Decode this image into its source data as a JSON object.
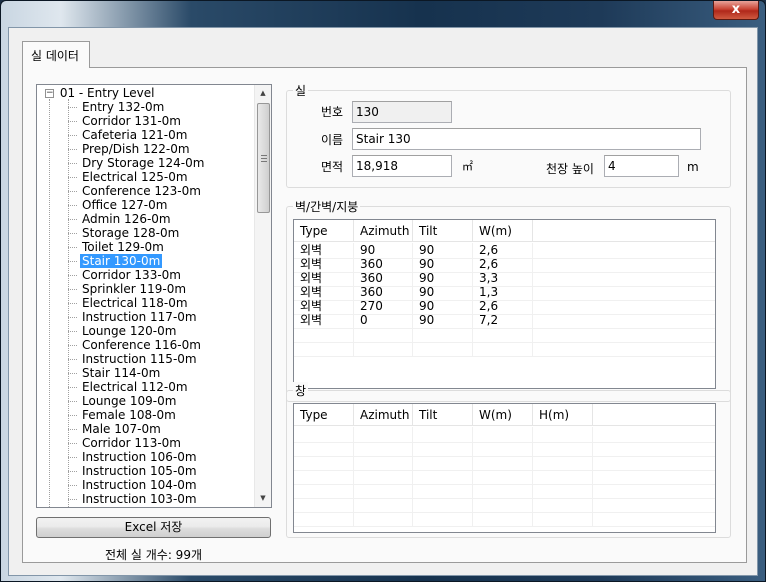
{
  "window": {
    "close_glyph": "x"
  },
  "tab": {
    "label": "실 데이터"
  },
  "tree": {
    "root_label": "01 - Entry Level",
    "expander_glyph": "−",
    "items": [
      "Entry 132-0m",
      "Corridor 131-0m",
      "Cafeteria 121-0m",
      "Prep/Dish 122-0m",
      "Dry Storage 124-0m",
      "Electrical 125-0m",
      "Conference 123-0m",
      "Office 127-0m",
      "Admin 126-0m",
      "Storage 128-0m",
      "Toilet 129-0m",
      "Stair 130-0m",
      "Corridor 133-0m",
      "Sprinkler 119-0m",
      "Electrical 118-0m",
      "Instruction 117-0m",
      "Lounge 120-0m",
      "Conference 116-0m",
      "Instruction 115-0m",
      "Stair 114-0m",
      "Electrical 112-0m",
      "Lounge 109-0m",
      "Female 108-0m",
      "Male 107-0m",
      "Corridor 113-0m",
      "Instruction 106-0m",
      "Instruction 105-0m",
      "Instruction 104-0m",
      "Instruction 103-0m"
    ],
    "selected_index": 11,
    "scroll": {
      "up_glyph": "▲",
      "down_glyph": "▼"
    }
  },
  "excel_button": {
    "label": "Excel 저장"
  },
  "count_label": "전체 실 개수: 99개",
  "room": {
    "group_title": "실",
    "number_label": "번호",
    "number_value": "130",
    "name_label": "이름",
    "name_value": "Stair 130",
    "area_label": "면적",
    "area_value": "18,918",
    "area_unit": "㎡",
    "height_label": "천장 높이",
    "height_value": "4",
    "height_unit": "m"
  },
  "walls": {
    "group_title": "벽/간벽/지붕",
    "columns": [
      "Type",
      "Azimuth",
      "Tilt",
      "W(m)"
    ],
    "rows": [
      [
        "외벽",
        "90",
        "90",
        "2,6"
      ],
      [
        "외벽",
        "360",
        "90",
        "2,6"
      ],
      [
        "외벽",
        "360",
        "90",
        "3,3"
      ],
      [
        "외벽",
        "360",
        "90",
        "1,3"
      ],
      [
        "외벽",
        "270",
        "90",
        "2,6"
      ],
      [
        "외벽",
        "0",
        "90",
        "7,2"
      ]
    ]
  },
  "windows": {
    "group_title": "창",
    "columns": [
      "Type",
      "Azimuth",
      "Tilt",
      "W(m)",
      "H(m)"
    ],
    "rows": []
  }
}
